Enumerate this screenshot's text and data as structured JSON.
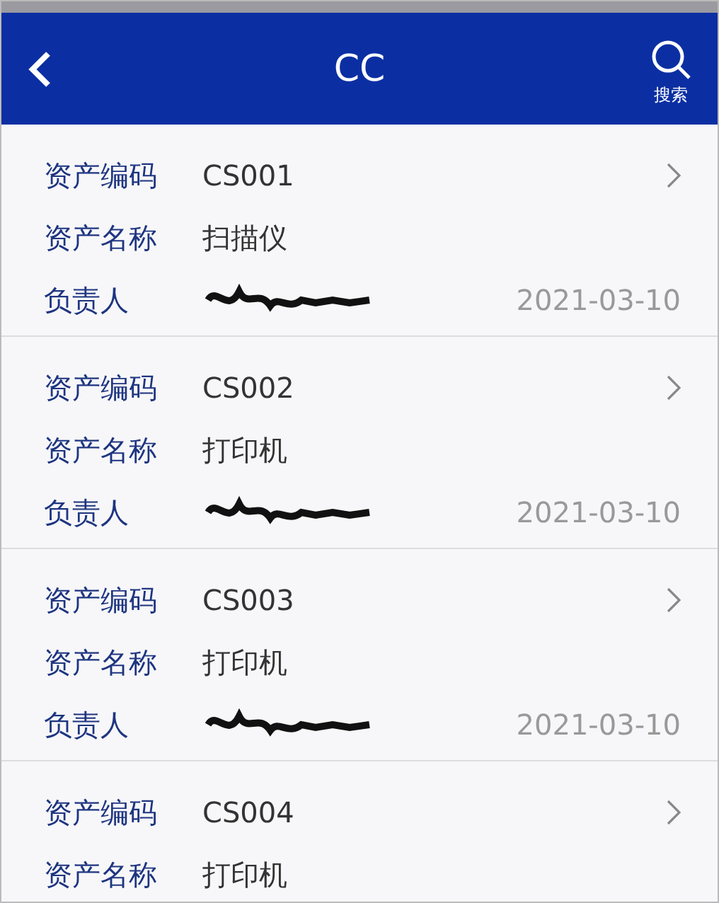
{
  "header": {
    "title": "CC",
    "search_label": "搜索"
  },
  "assets": [
    {
      "code_label": "资产编码",
      "code": "CS001",
      "name_label": "资产名称",
      "name": "扫描仪",
      "owner_label": "负责人",
      "owner_redacted": true,
      "date": "2021-03-10"
    },
    {
      "code_label": "资产编码",
      "code": "CS002",
      "name_label": "资产名称",
      "name": "打印机",
      "owner_label": "负责人",
      "owner_redacted": true,
      "date": "2021-03-10"
    },
    {
      "code_label": "资产编码",
      "code": "CS003",
      "name_label": "资产名称",
      "name": "打印机",
      "owner_label": "负责人",
      "owner_redacted": true,
      "date": "2021-03-10"
    },
    {
      "code_label": "资产编码",
      "code": "CS004",
      "name_label": "资产名称",
      "name": "打印机"
    }
  ]
}
